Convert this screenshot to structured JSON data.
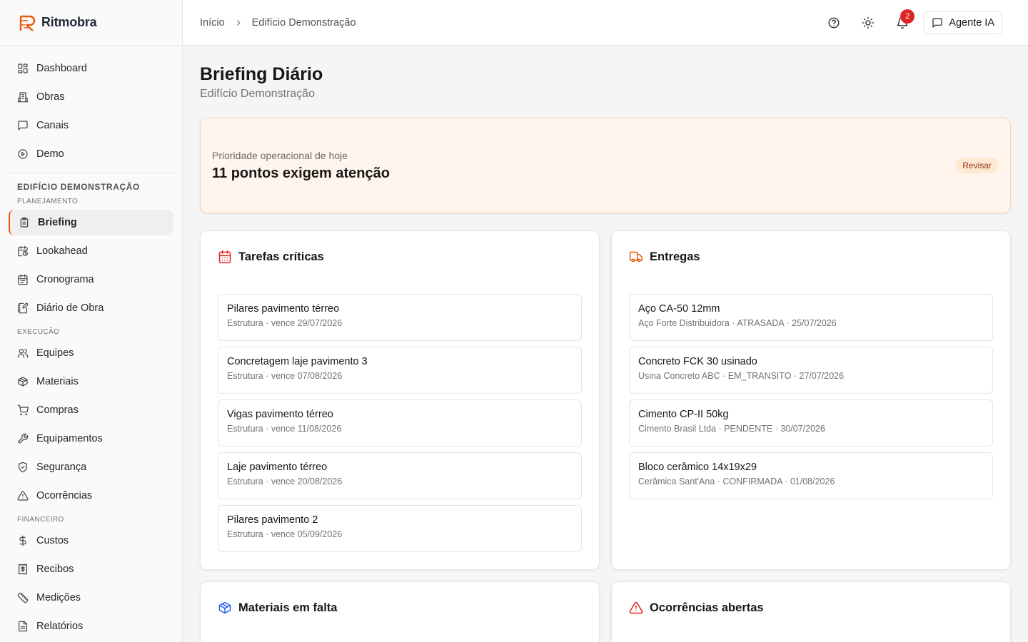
{
  "brand": {
    "name": "Ritmobra",
    "accent": "#ea580c"
  },
  "nav_main": [
    {
      "label": "Dashboard",
      "icon": "dashboard-icon"
    },
    {
      "label": "Obras",
      "icon": "building-icon"
    },
    {
      "label": "Canais",
      "icon": "chat-icon"
    },
    {
      "label": "Demo",
      "icon": "play-icon"
    }
  ],
  "project": {
    "title": "EDIFÍCIO DEMONSTRAÇÃO"
  },
  "sections": {
    "planejamento": "PLANEJAMENTO",
    "execucao": "EXECUÇÃO",
    "financeiro": "FINANCEIRO"
  },
  "nav_planejamento": [
    {
      "label": "Briefing",
      "icon": "clipboard-icon",
      "active": true
    },
    {
      "label": "Lookahead",
      "icon": "calendar-clock-icon"
    },
    {
      "label": "Cronograma",
      "icon": "calendar-icon"
    },
    {
      "label": "Diário de Obra",
      "icon": "notebook-pen-icon"
    }
  ],
  "nav_execucao": [
    {
      "label": "Equipes",
      "icon": "users-icon"
    },
    {
      "label": "Materiais",
      "icon": "package-icon"
    },
    {
      "label": "Compras",
      "icon": "cart-icon"
    },
    {
      "label": "Equipamentos",
      "icon": "wrench-icon"
    },
    {
      "label": "Segurança",
      "icon": "shield-icon"
    },
    {
      "label": "Ocorrências",
      "icon": "warning-icon"
    }
  ],
  "nav_financeiro": [
    {
      "label": "Custos",
      "icon": "dollar-icon"
    },
    {
      "label": "Recibos",
      "icon": "receipt-icon"
    },
    {
      "label": "Medições",
      "icon": "ruler-icon"
    },
    {
      "label": "Relatórios",
      "icon": "report-icon"
    }
  ],
  "breadcrumb": {
    "home": "Início",
    "current": "Edifício Demonstração"
  },
  "header": {
    "notifications_count": "2",
    "agent_label": "Agente IA"
  },
  "page": {
    "title": "Briefing Diário",
    "subtitle": "Edifício Demonstração"
  },
  "priority": {
    "label": "Prioridade operacional de hoje",
    "title": "11 pontos exigem atenção",
    "badge": "Revisar"
  },
  "tarefas": {
    "title": "Tarefas críticas",
    "items": [
      {
        "title": "Pilares pavimento térreo",
        "meta": "Estrutura · vence 29/07/2026"
      },
      {
        "title": "Concretagem laje pavimento 3",
        "meta": "Estrutura · vence 07/08/2026"
      },
      {
        "title": "Vigas pavimento térreo",
        "meta": "Estrutura · vence 11/08/2026"
      },
      {
        "title": "Laje pavimento térreo",
        "meta": "Estrutura · vence 20/08/2026"
      },
      {
        "title": "Pilares pavimento 2",
        "meta": "Estrutura · vence 05/09/2026"
      }
    ]
  },
  "entregas": {
    "title": "Entregas",
    "items": [
      {
        "title": "Aço CA-50 12mm",
        "meta": "Aço Forte Distribuidora · ATRASADA · 25/07/2026"
      },
      {
        "title": "Concreto FCK 30 usinado",
        "meta": "Usina Concreto ABC · EM_TRANSITO · 27/07/2026"
      },
      {
        "title": "Cimento CP-II 50kg",
        "meta": "Cimento Brasil Ltda · PENDENTE · 30/07/2026"
      },
      {
        "title": "Bloco cerâmico 14x19x29",
        "meta": "Cerâmica Sant'Ana · CONFIRMADA · 01/08/2026"
      }
    ]
  },
  "materiais": {
    "title": "Materiais em falta"
  },
  "ocorrencias": {
    "title": "Ocorrências abertas"
  },
  "colors": {
    "tasks_icon": "#dc2626",
    "deliveries_icon": "#ea580c",
    "materials_icon": "#2563eb",
    "incidents_icon": "#dc2626"
  }
}
